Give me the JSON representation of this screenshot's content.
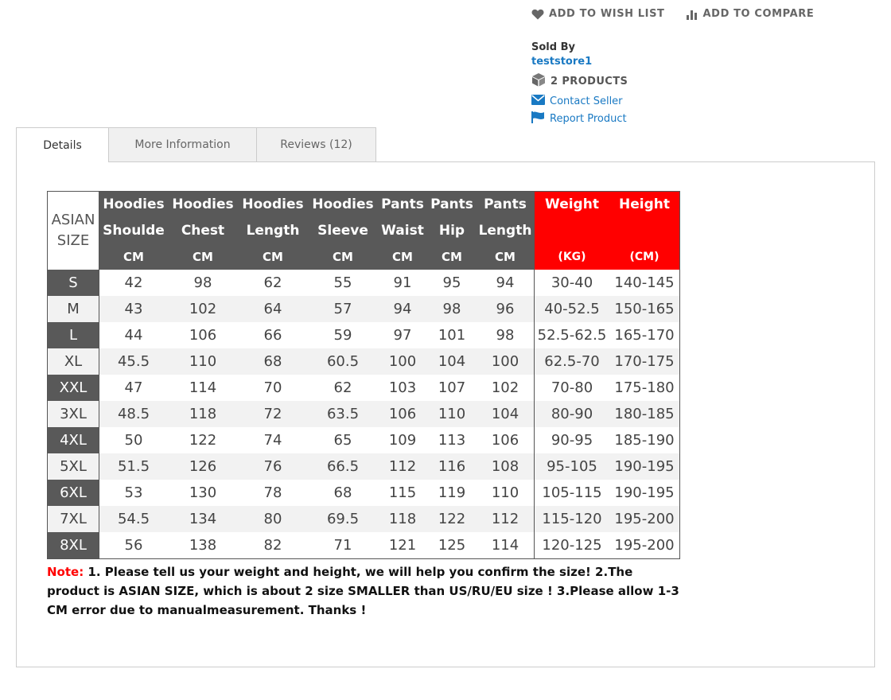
{
  "actions": {
    "wishlist_label": "ADD TO WISH LIST",
    "compare_label": "ADD TO COMPARE"
  },
  "seller": {
    "sold_by_label": "Sold By",
    "store_name": "teststore1",
    "products_label": "2 PRODUCTS",
    "contact_label": "Contact Seller",
    "report_label": "Report Product"
  },
  "tabs": [
    {
      "label": "Details",
      "active": true
    },
    {
      "label": "More Information",
      "active": false
    },
    {
      "label": "Reviews (12)",
      "active": false
    }
  ],
  "size_chart": {
    "corner_label_line1": "ASIAN",
    "corner_label_line2": "SIZE",
    "headers": [
      {
        "line1": "Hoodies",
        "line2": "Shoulde",
        "unit": "CM"
      },
      {
        "line1": "Hoodies",
        "line2": "Chest",
        "unit": "CM"
      },
      {
        "line1": "Hoodies",
        "line2": "Length",
        "unit": "CM"
      },
      {
        "line1": "Hoodies",
        "line2": "Sleeve",
        "unit": "CM"
      },
      {
        "line1": "Pants",
        "line2": "Waist",
        "unit": "CM"
      },
      {
        "line1": "Pants",
        "line2": "Hip",
        "unit": "CM"
      },
      {
        "line1": "Pants",
        "line2": "Length",
        "unit": "CM"
      },
      {
        "line1": "Weight",
        "line2": "",
        "unit": "(KG)"
      },
      {
        "line1": "Height",
        "line2": "",
        "unit": "(CM)"
      }
    ],
    "rows": [
      {
        "size": "S",
        "values": [
          "42",
          "98",
          "62",
          "55",
          "91",
          "95",
          "94",
          "30-40",
          "140-145"
        ]
      },
      {
        "size": "M",
        "values": [
          "43",
          "102",
          "64",
          "57",
          "94",
          "98",
          "96",
          "40-52.5",
          "150-165"
        ]
      },
      {
        "size": "L",
        "values": [
          "44",
          "106",
          "66",
          "59",
          "97",
          "101",
          "98",
          "52.5-62.5",
          "165-170"
        ]
      },
      {
        "size": "XL",
        "values": [
          "45.5",
          "110",
          "68",
          "60.5",
          "100",
          "104",
          "100",
          "62.5-70",
          "170-175"
        ]
      },
      {
        "size": "XXL",
        "values": [
          "47",
          "114",
          "70",
          "62",
          "103",
          "107",
          "102",
          "70-80",
          "175-180"
        ]
      },
      {
        "size": "3XL",
        "values": [
          "48.5",
          "118",
          "72",
          "63.5",
          "106",
          "110",
          "104",
          "80-90",
          "180-185"
        ]
      },
      {
        "size": "4XL",
        "values": [
          "50",
          "122",
          "74",
          "65",
          "109",
          "113",
          "106",
          "90-95",
          "185-190"
        ]
      },
      {
        "size": "5XL",
        "values": [
          "51.5",
          "126",
          "76",
          "66.5",
          "112",
          "116",
          "108",
          "95-105",
          "190-195"
        ]
      },
      {
        "size": "6XL",
        "values": [
          "53",
          "130",
          "78",
          "68",
          "115",
          "119",
          "110",
          "105-115",
          "190-195"
        ]
      },
      {
        "size": "7XL",
        "values": [
          "54.5",
          "134",
          "80",
          "69.5",
          "118",
          "122",
          "112",
          "115-120",
          "195-200"
        ]
      },
      {
        "size": "8XL",
        "values": [
          "56",
          "138",
          "82",
          "71",
          "121",
          "125",
          "114",
          "120-125",
          "195-200"
        ]
      }
    ],
    "note_prefix": "Note:",
    "note_text": " 1. Please tell us your weight and height, we will help you confirm the size!  2.The product is ASIAN SIZE, which is about 2 size SMALLER than US/RU/EU size ! 3.Please allow 1-3 CM error due to manualmeasurement.  Thanks !"
  },
  "colors": {
    "link": "#1979c3",
    "header_dark": "#595959",
    "header_red": "#ff0000",
    "note_red": "#ff0000"
  }
}
